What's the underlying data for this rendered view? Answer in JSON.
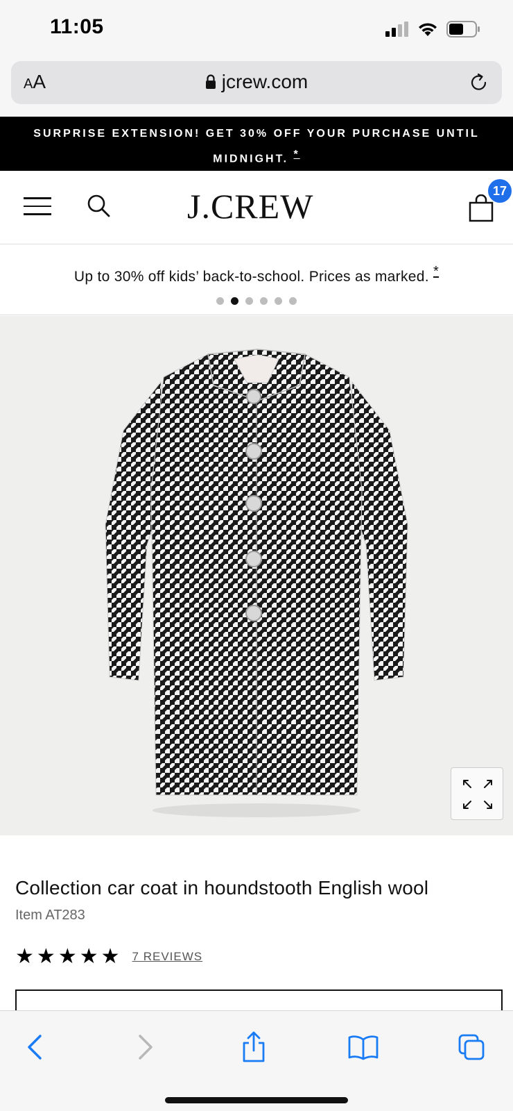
{
  "status_bar": {
    "time": "11:05"
  },
  "browser": {
    "aa_label_small": "A",
    "aa_label_large": "A",
    "url": "jcrew.com"
  },
  "promo_banner": {
    "line1": "SURPRISE EXTENSION! GET 30% OFF YOUR PURCHASE UNTIL",
    "line2": "MIDNIGHT.",
    "asterisk": "*"
  },
  "header": {
    "brand": "J.CREW",
    "bag_count": "17"
  },
  "sub_promo": {
    "text": "Up to 30% off kids’ back-to-school. Prices as marked.",
    "asterisk": "*",
    "slides_total": 6,
    "active_slide": 2
  },
  "product": {
    "title": "Collection car coat in houndstooth English wool",
    "item": "Item AT283",
    "rating_stars": 5,
    "reviews_label": "7 REVIEWS"
  },
  "colors": {
    "accent_badge": "#1f6feb",
    "ios_blue": "#1a7cf5",
    "banner_bg": "#000000"
  },
  "icons": {
    "signal": "signal-icon",
    "wifi": "wifi-icon",
    "battery": "battery-icon",
    "lock": "lock-icon",
    "reload": "reload-icon",
    "menu": "menu-icon",
    "search": "search-icon",
    "bag": "bag-icon",
    "expand": "expand-icon",
    "back": "back-icon",
    "forward": "forward-icon",
    "share": "share-icon",
    "bookmarks": "bookmarks-icon",
    "tabs": "tabs-icon"
  }
}
